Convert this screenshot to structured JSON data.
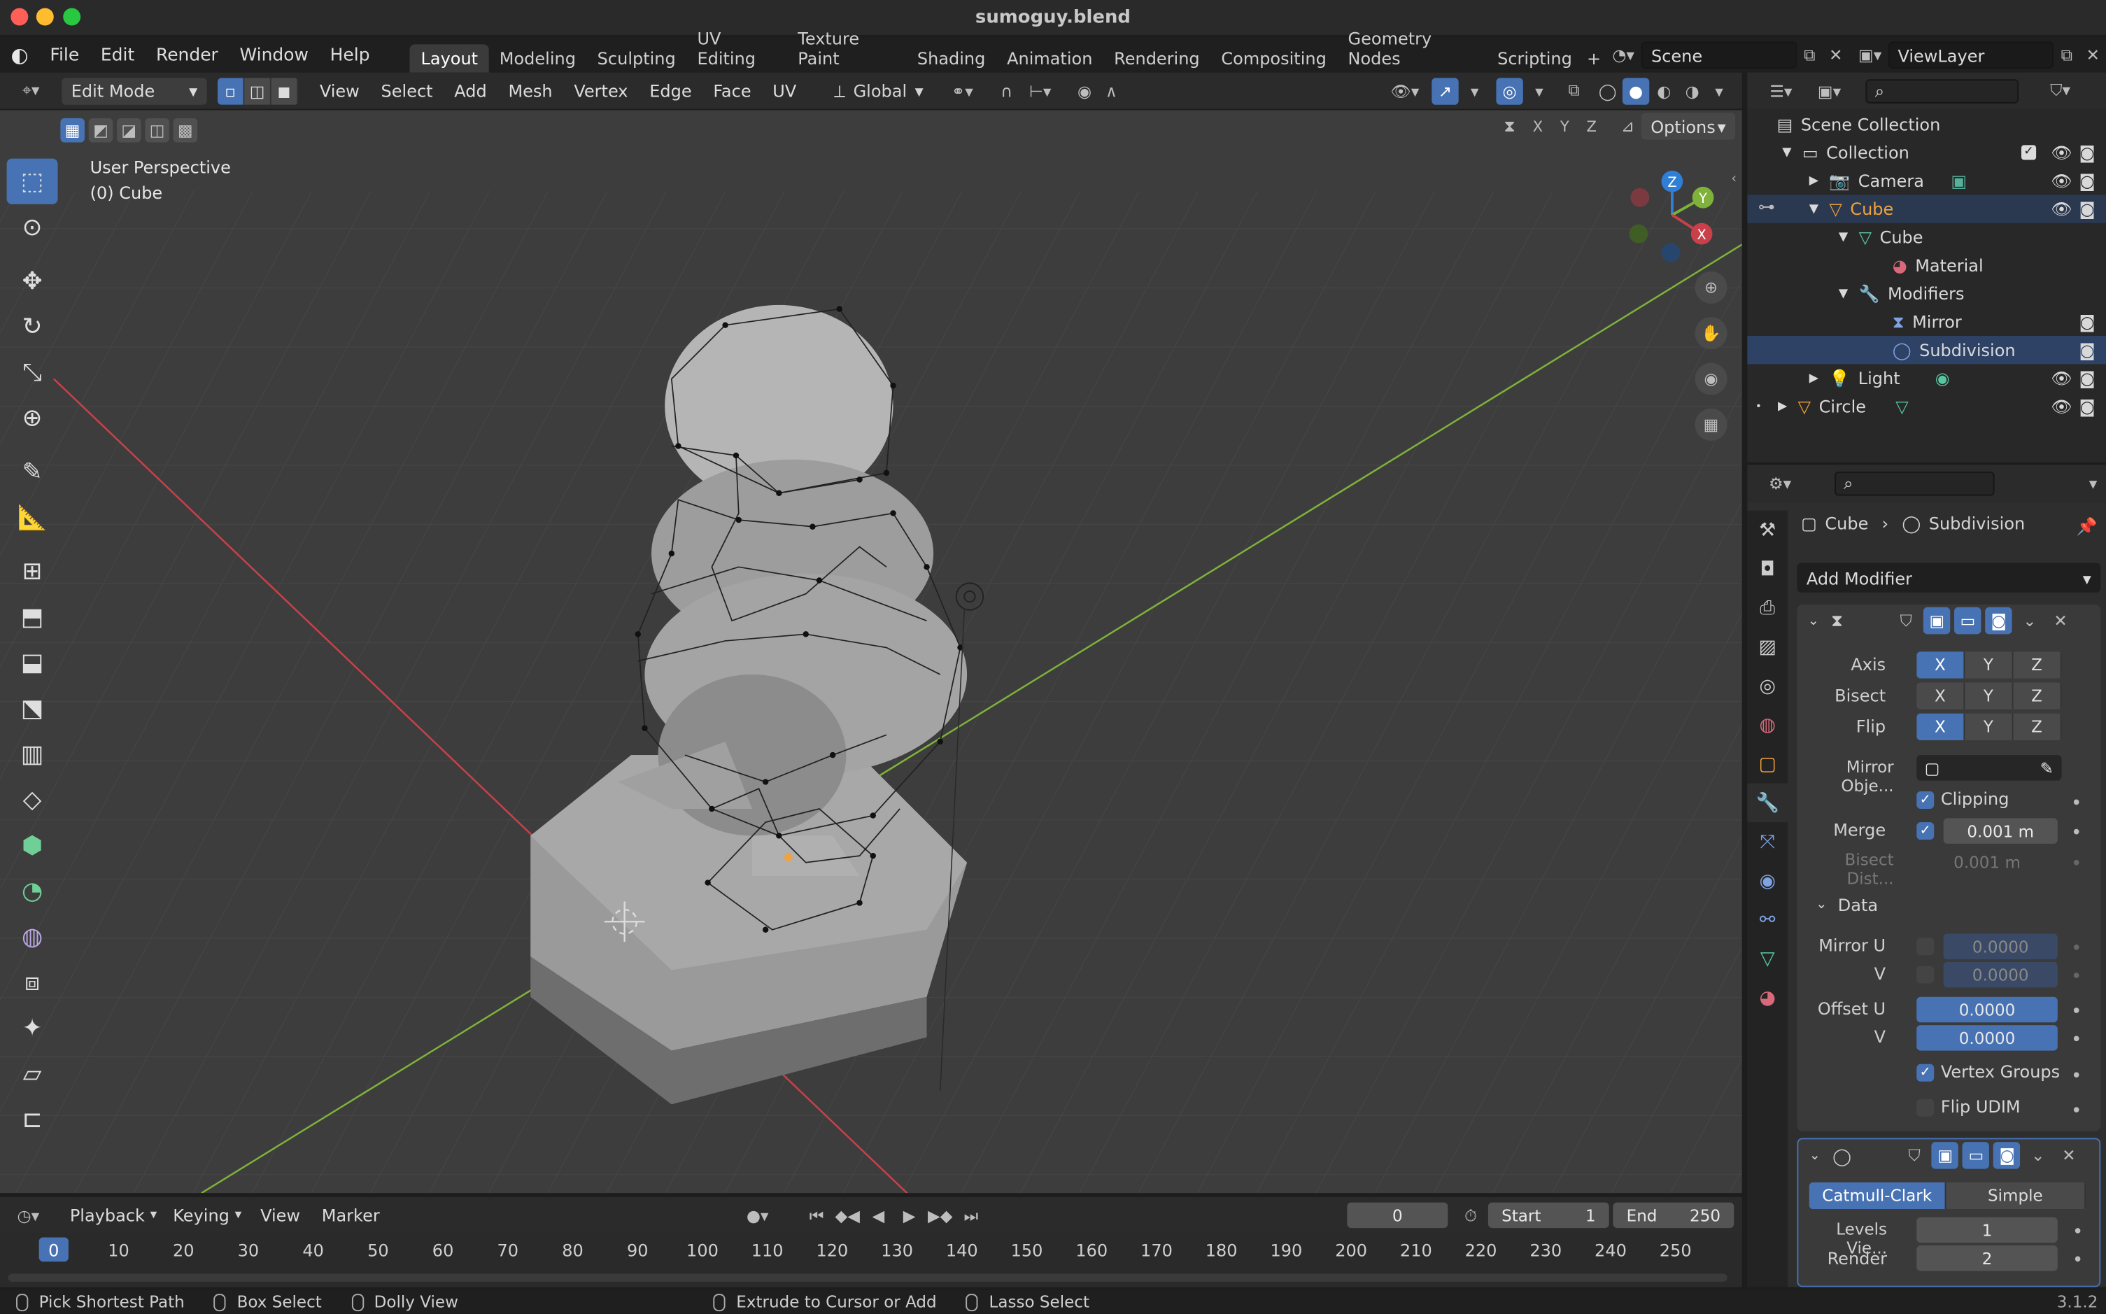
{
  "window": {
    "title": "sumoguy.blend"
  },
  "menu": [
    "File",
    "Edit",
    "Render",
    "Window",
    "Help"
  ],
  "workspaces": [
    "Layout",
    "Modeling",
    "Sculpting",
    "UV Editing",
    "Texture Paint",
    "Shading",
    "Animation",
    "Rendering",
    "Compositing",
    "Geometry Nodes",
    "Scripting"
  ],
  "workspace_add": "+",
  "scene_name": "Scene",
  "view_layer": "ViewLayer",
  "viewport_header": {
    "mode": "Edit Mode",
    "menus": [
      "View",
      "Select",
      "Add",
      "Mesh",
      "Vertex",
      "Edge",
      "Face",
      "UV"
    ],
    "transform_orientation": "Global",
    "options_label": "Options",
    "axis_x": "X",
    "axis_y": "Y",
    "axis_z": "Z"
  },
  "viewport": {
    "perspective_label": "User Perspective",
    "object_label": "(0) Cube",
    "gizmo_x": "X",
    "gizmo_y": "Y",
    "gizmo_z": "Z"
  },
  "outliner": {
    "items": [
      {
        "label": "Scene Collection"
      },
      {
        "label": "Collection"
      },
      {
        "label": "Camera"
      },
      {
        "label": "Cube"
      },
      {
        "label": "Cube"
      },
      {
        "label": "Material"
      },
      {
        "label": "Modifiers"
      },
      {
        "label": "Mirror"
      },
      {
        "label": "Subdivision"
      },
      {
        "label": "Light"
      },
      {
        "label": "Circle"
      }
    ]
  },
  "properties": {
    "breadcrumb_object": "Cube",
    "breadcrumb_modifier": "Subdivision",
    "add_modifier": "Add Modifier",
    "mirror": {
      "axis_label": "Axis",
      "bisect_label": "Bisect",
      "flip_label": "Flip",
      "x": "X",
      "y": "Y",
      "z": "Z",
      "mirror_object_label": "Mirror Obje...",
      "clipping_label": "Clipping",
      "merge_label": "Merge",
      "merge_value": "0.001 m",
      "bisect_dist_label": "Bisect Dist...",
      "bisect_dist_value": "0.001 m",
      "data_label": "Data",
      "mirror_u_label": "Mirror U",
      "mirror_u_value": "0.0000",
      "v_label": "V",
      "mirror_v_value": "0.0000",
      "offset_u_label": "Offset U",
      "offset_u_value": "0.0000",
      "offset_v_value": "0.0000",
      "vertex_groups_label": "Vertex Groups",
      "flip_udim_label": "Flip UDIM"
    },
    "subdivision": {
      "catmull_label": "Catmull-Clark",
      "simple_label": "Simple",
      "levels_viewport_label": "Levels Vie...",
      "levels_viewport_value": "1",
      "render_label": "Render",
      "render_value": "2"
    }
  },
  "timeline": {
    "menus": [
      "Playback",
      "Keying",
      "View",
      "Marker"
    ],
    "current_frame": "0",
    "start_label": "Start",
    "start_value": "1",
    "end_label": "End",
    "end_value": "250",
    "ticks": [
      "0",
      "10",
      "20",
      "30",
      "40",
      "50",
      "60",
      "70",
      "80",
      "90",
      "100",
      "110",
      "120",
      "130",
      "140",
      "150",
      "160",
      "170",
      "180",
      "190",
      "200",
      "210",
      "220",
      "230",
      "240",
      "250"
    ]
  },
  "statusbar": {
    "items": [
      "Pick Shortest Path",
      "Box Select",
      "Dolly View",
      "Extrude to Cursor or Add",
      "Lasso Select"
    ],
    "version": "3.1.2"
  },
  "colors": {
    "accent": "#4772b3",
    "x_axis": "#c9404a",
    "y_axis": "#7fb23a",
    "z_axis": "#2f7fd6",
    "active_object": "#f0a23c"
  }
}
